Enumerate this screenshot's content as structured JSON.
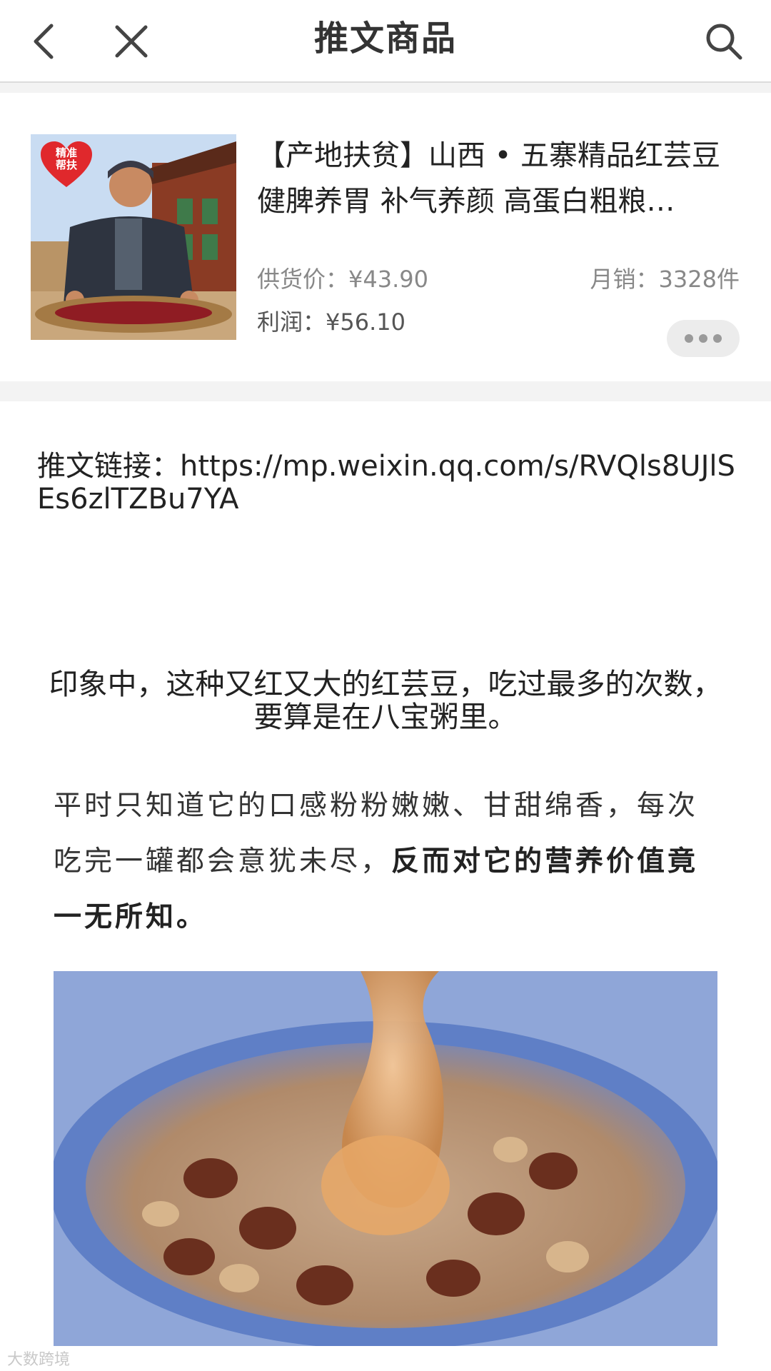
{
  "header": {
    "title": "推文商品",
    "icons": {
      "back": "chevron-left-icon",
      "close": "close-icon",
      "search": "search-icon"
    }
  },
  "product": {
    "title": "【产地扶贫】山西 • 五寨精品红芸豆 健脾养胃 补气养颜 高蛋白粗粮…",
    "supply_price": "供货价：¥43.90",
    "monthly_sales": "月销：3328件",
    "profit": "利润：¥56.10",
    "badge_text": "精准帮扶"
  },
  "article": {
    "link_text": "推文链接：https://mp.weixin.qq.com/s/RVQls8UJlSEs6zlTZBu7YA",
    "intro": "印象中，这种又红又大的红芸豆，吃过最多的次数，要算是在八宝粥里。",
    "paragraph_normal": "平时只知道它的口感粉粉嫩嫩、甘甜绵香，每次吃完一罐都会意犹未尽，",
    "paragraph_bold": "反而对它的营养价值竟一无所知。"
  },
  "watermark": "大数跨境",
  "colors": {
    "background": "#ffffff",
    "separator": "#f3f3f3",
    "text_primary": "#222222",
    "text_secondary": "#888888",
    "badge_red": "#e0282c"
  }
}
